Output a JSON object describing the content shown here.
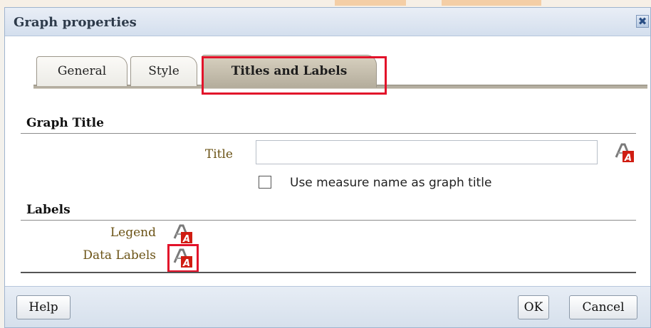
{
  "dialog": {
    "title": "Graph properties",
    "close_glyph": "✖"
  },
  "tabs": [
    {
      "label": "General"
    },
    {
      "label": "Style"
    },
    {
      "label": "Titles and Labels"
    }
  ],
  "graph_title_section": {
    "header": "Graph Title",
    "title_label": "Title",
    "title_value": "",
    "use_measure_label": "Use measure name as graph title",
    "use_measure_checked": false
  },
  "labels_section": {
    "header": "Labels",
    "legend_label": "Legend",
    "data_labels_label": "Data Labels"
  },
  "footer": {
    "help_label": "Help",
    "ok_label": "OK",
    "cancel_label": "Cancel"
  },
  "icons": {
    "format_icon": "text-format-icon"
  },
  "colors": {
    "highlight": "#e2122a",
    "label_text": "#6b5316",
    "active_tab": "#c4bdac"
  }
}
